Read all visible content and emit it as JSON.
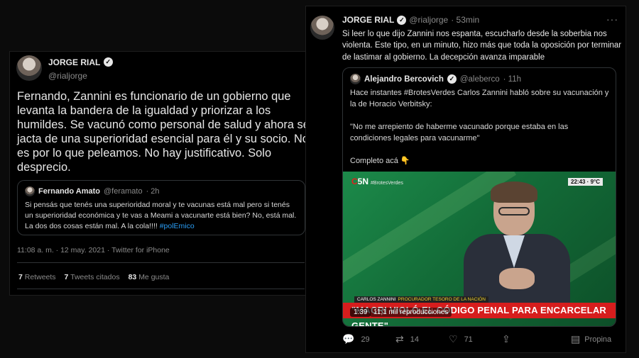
{
  "left_tweet": {
    "name": "JORGE RIAL",
    "handle": "@rialjorge",
    "text": "Fernando, Zannini es funcionario de un gobierno que levanta la bandera de la igualdad y priorizar a los humildes. Se vacunó como personal de salud y ahora se jacta de una superioridad esencial para él y su socio. No es por lo que peleamos. No hay justificativo. Solo desprecio.",
    "quote": {
      "name": "Fernando Amato",
      "handle": "@feramato",
      "time": "· 2h",
      "text": "Si pensás que tenés una superioridad moral y te vacunas está mal pero si tenés un superioridad económica y te vas a Meami a vacunarte está bien? No, está mal. La dos dos cosas están mal. A la cola!!!! ",
      "hashtag": "#polEmico"
    },
    "meta": "11:08 a. m. · 12 may. 2021 · Twitter for iPhone",
    "stats": {
      "retweets_count": "7",
      "retweets_label": "Retweets",
      "quotes_count": "7",
      "quotes_label": "Tweets citados",
      "likes_count": "83",
      "likes_label": "Me gusta"
    }
  },
  "right_tweet": {
    "name": "JORGE RIAL",
    "handle": "@rialjorge",
    "time": "· 53min",
    "more": "···",
    "text": "Si leer lo que dijo Zannini nos espanta, escucharlo desde la soberbia nos violenta. Este tipo, en un minuto, hizo más que toda la oposición por terminar de lastimar al gobierno. La decepción avanza imparable",
    "quote": {
      "name": "Alejandro Bercovich",
      "handle": "@aleberco",
      "time": "· 11h",
      "line1": "Hace instantes #BrotesVerdes Carlos Zannini habló sobre su vacunación y la de Horacio Verbitsky:",
      "line2": "\"No me arrepiento de haberme vacunado porque estaba en las condiciones legales para vacunarme\"",
      "line3": "Completo acá 👇"
    },
    "video": {
      "logo_c": "C",
      "logo_rest": "5N",
      "logo_tag": "#BrotesVerdes",
      "clock": "22:43 · 9°C",
      "caption_name": "CARLOS ZANNINI",
      "caption_role": "PROCURADOR TESORO DE LA NACIÓN",
      "headline": "\"MACRI VIOLÓ EL CÓDIGO PENAL PARA ENCARCELAR GENTE\"",
      "duration": "1:39",
      "views": "11,1 mil reproducciones"
    },
    "actions": {
      "replies": "29",
      "retweets": "14",
      "likes": "71",
      "promote": "Propina"
    }
  }
}
